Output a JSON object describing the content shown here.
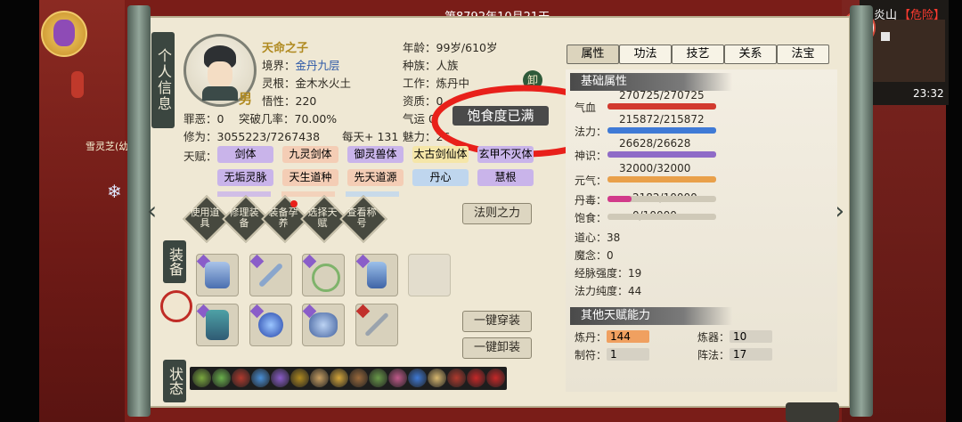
{
  "date": "第8792年10月21天",
  "map": {
    "location_suffix": "炎山",
    "danger": "【危险】",
    "time": "23:32"
  },
  "npc_label": "雪灵芝(幼",
  "side_tabs": {
    "info": "个人信息",
    "equip": "装备",
    "status": "状态"
  },
  "profile": {
    "name": "天命之子",
    "gender": "男",
    "realm_label": "境界：",
    "realm": "金丹九层",
    "root_label": "灵根：",
    "root": "金木水火土",
    "insight_label": "悟性：",
    "insight": "220",
    "sin_label": "罪恶：",
    "sin": "0",
    "breakthrough_label": "突破几率：",
    "breakthrough": "70.00%",
    "cultivation_label": "修为：",
    "cultivation": "3055223/7267438",
    "per_day": "每天+ 131",
    "age_label": "年龄：",
    "age": "99岁/610岁",
    "race_label": "种族：",
    "race": "人族",
    "job_label": "工作：",
    "job": "炼丹中",
    "unload": "卸",
    "aptitude_label": "资质：",
    "aptitude": "0",
    "luck_label": "气运",
    "luck": "0",
    "charm_label": "魅力：",
    "charm": "26"
  },
  "toast": "饱食度已满",
  "talents": {
    "label": "天赋：",
    "items": [
      {
        "name": "剑体",
        "color": "#c9b4ea"
      },
      {
        "name": "九灵剑体",
        "color": "#f4cdb5"
      },
      {
        "name": "御灵兽体",
        "color": "#c9b4ea"
      },
      {
        "name": "太古剑仙体",
        "color": "#f5e6a8"
      },
      {
        "name": "玄甲不灭体",
        "color": "#c9b4ea"
      },
      {
        "name": "无垢灵脉",
        "color": "#c9b4ea"
      },
      {
        "name": "天生道种",
        "color": "#f4cdb5"
      },
      {
        "name": "先天道源",
        "color": "#f4cdb5"
      },
      {
        "name": "丹心",
        "color": "#bfd6ee"
      },
      {
        "name": "慧根",
        "color": "#c9b4ea"
      }
    ]
  },
  "actions": [
    {
      "label": "使用道具"
    },
    {
      "label": "修理装备"
    },
    {
      "label": "装备孕养"
    },
    {
      "label": "选择天赋"
    },
    {
      "label": "查看称号"
    }
  ],
  "law_button": "法则之力",
  "equip_all": "一键穿装",
  "unequip_all": "一键卸装",
  "tabs": [
    {
      "label": "属性",
      "active": true
    },
    {
      "label": "功法",
      "active": false
    },
    {
      "label": "技艺",
      "active": false
    },
    {
      "label": "关系",
      "active": false
    },
    {
      "label": "法宝",
      "active": false
    }
  ],
  "basic_attrs": {
    "title": "基础属性",
    "bars": [
      {
        "label": "气血",
        "value": "270725/270725",
        "fraction": 1.0,
        "color": "#d23a2f"
      },
      {
        "label": "法力：",
        "value": "215872/215872",
        "fraction": 1.0,
        "color": "#3f7ad6"
      },
      {
        "label": "神识：",
        "value": "26628/26628",
        "fraction": 1.0,
        "color": "#8f6bc7"
      },
      {
        "label": "元气：",
        "value": "32000/32000",
        "fraction": 1.0,
        "color": "#e9a04a"
      },
      {
        "label": "丹毒：",
        "value": "2182/10000",
        "fraction": 0.2182,
        "color": "#d23a8a"
      },
      {
        "label": "饱食：",
        "value": "0/10000",
        "fraction": 0.0,
        "color": "#7fb64b"
      }
    ],
    "stats": [
      {
        "label": "道心：",
        "value": "38"
      },
      {
        "label": "魔念：",
        "value": "0"
      },
      {
        "label": "经脉强度：",
        "value": "19"
      },
      {
        "label": "法力纯度：",
        "value": "44"
      }
    ]
  },
  "other_abilities": {
    "title": "其他天赋能力",
    "items": [
      {
        "label": "炼丹：",
        "value": "144",
        "highlight": true
      },
      {
        "label": "炼器：",
        "value": "10",
        "highlight": false
      },
      {
        "label": "制符：",
        "value": "1",
        "highlight": false
      },
      {
        "label": "阵法：",
        "value": "17",
        "highlight": false
      }
    ]
  }
}
